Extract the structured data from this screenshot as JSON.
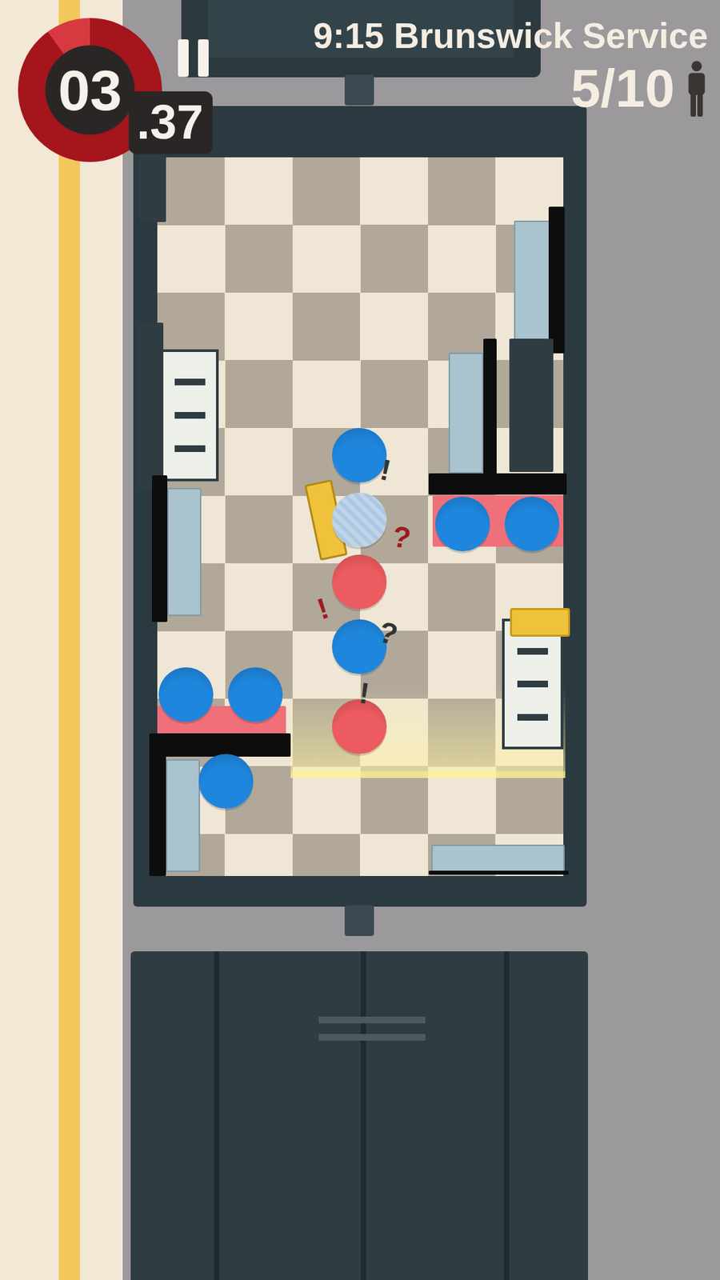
{
  "service": {
    "title": "9:15 Brunswick Service"
  },
  "timer": {
    "seconds": "03",
    "fraction": ".37",
    "level": 0.9
  },
  "boarded": {
    "count": "5/10"
  },
  "passengers": [
    {
      "color": "#1f86dd",
      "mark": "!",
      "mark_color": "#333333",
      "selected": false
    },
    {
      "color": "#1f86dd",
      "mark": "?",
      "mark_color": "#9b1b1f",
      "selected": true
    },
    {
      "color": "#1f86dd",
      "mark": "",
      "mark_color": "#333333",
      "selected": false
    },
    {
      "color": "#1f86dd",
      "mark": "",
      "mark_color": "#333333",
      "selected": false
    },
    {
      "color": "#ec5b5f",
      "mark": "!",
      "mark_color": "#9b1b1f",
      "selected": false
    },
    {
      "color": "#1f86dd",
      "mark": "?",
      "mark_color": "#333333",
      "selected": false
    },
    {
      "color": "#ec5b5f",
      "mark": "!",
      "mark_color": "#333333",
      "selected": false
    },
    {
      "color": "#1f86dd",
      "mark": "",
      "mark_color": "#333333",
      "selected": false
    },
    {
      "color": "#1f86dd",
      "mark": "",
      "mark_color": "#333333",
      "selected": false
    },
    {
      "color": "#1f86dd",
      "mark": "",
      "mark_color": "#333333",
      "selected": false
    }
  ]
}
